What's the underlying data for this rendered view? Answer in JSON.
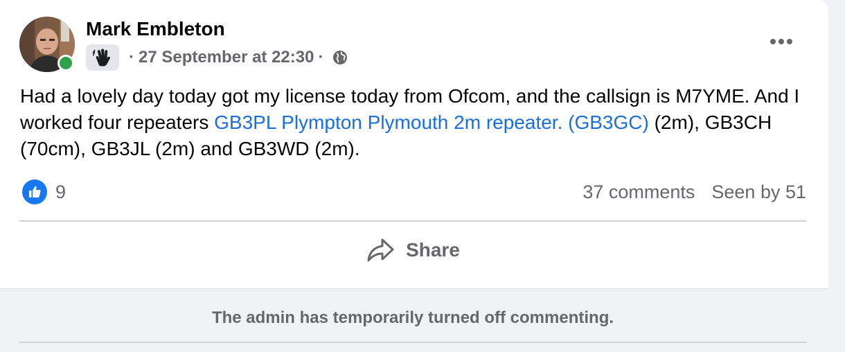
{
  "post": {
    "author": "Mark Embleton",
    "badge_icon": "waving-hand-icon",
    "separator": "·",
    "timestamp": "27 September at 22:30",
    "audience_icon": "globe-icon",
    "more_icon": "more-options-icon",
    "text_part1": "Had a lovely day today got my license today from Ofcom, and the callsign is M7YME. And I worked four repeaters ",
    "link_text": "GB3PL Plympton Plymouth 2m repeater. (GB3GC)",
    "text_part2": " (2m), GB3CH (70cm), GB3JL (2m) and GB3WD (2m).",
    "link_color": "#1a6fe0"
  },
  "reactions": {
    "icon": "like-icon",
    "count": "9"
  },
  "stats": {
    "comments": "37 comments",
    "seen_by": "Seen by 51"
  },
  "actions": {
    "share_icon": "share-arrow-icon",
    "share_label": "Share"
  },
  "footer": {
    "notice": "The admin has temporarily turned off commenting."
  },
  "colors": {
    "accent": "#1877f2",
    "online": "#31a24c",
    "secondary_text": "#65676b"
  }
}
